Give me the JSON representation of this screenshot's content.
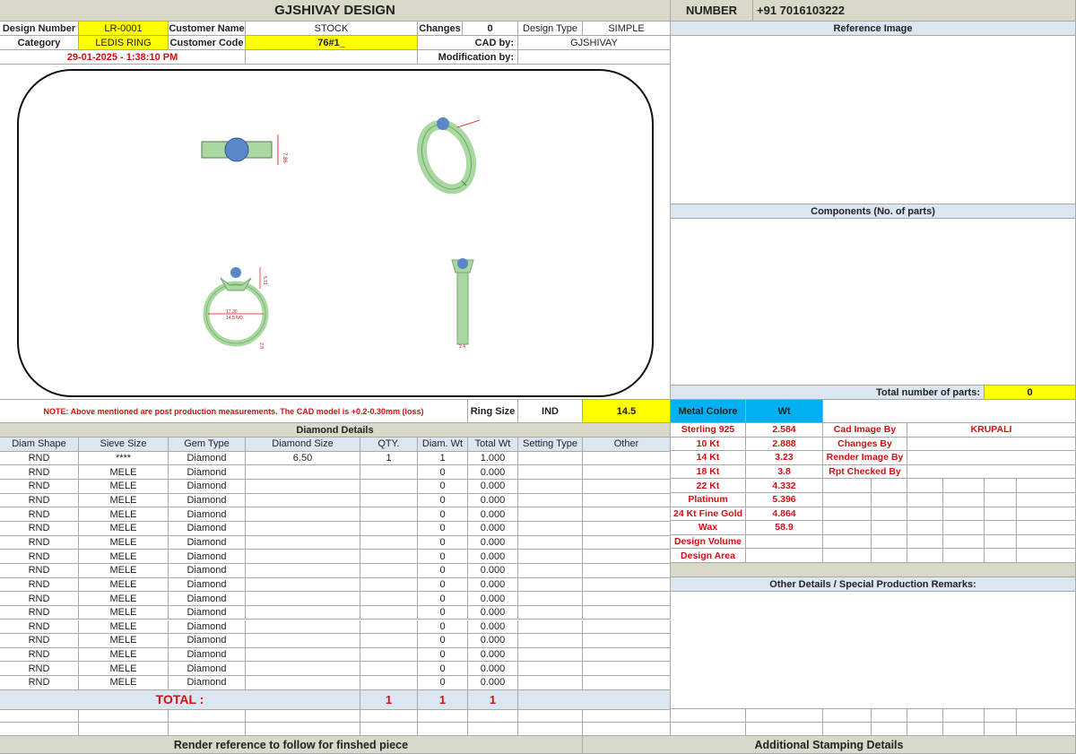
{
  "header": {
    "title": "GJSHIVAY DESIGN",
    "number_label": "NUMBER",
    "number_value": "+91 7016103222"
  },
  "info": {
    "design_number_label": "Design Number",
    "design_number": "LR-0001",
    "customer_name_label": "Customer Name",
    "customer_name": "STOCK",
    "changes_label": "Changes",
    "changes": "0",
    "design_type_label": "Design Type",
    "design_type": "SIMPLE",
    "category_label": "Category",
    "category": "LEDIS RING",
    "customer_code_label": "Customer Code",
    "customer_code": "76#1_",
    "cad_by_label": "CAD by:",
    "cad_by": "GJSHIVAY",
    "datetime": "29-01-2025 - 1:38:10 PM",
    "modification_label": "Modification by:"
  },
  "sections": {
    "reference_image": "Reference Image",
    "components": "Components (No. of parts)",
    "total_parts_label": "Total number of parts:",
    "total_parts": "0",
    "other_details": "Other Details / Special Production Remarks:",
    "render_reference": "Render reference to follow for finshed piece",
    "stamping": "Additional Stamping Details"
  },
  "drawing": {
    "dim_top": "7.86",
    "dim_inner": "17.30",
    "dim_size": "14.5 NO.",
    "dim_shank": "2.8",
    "dim_height": "5.71",
    "dim_side": "2.4"
  },
  "note": {
    "text": "NOTE: Above mentioned are post production measurements. The CAD model is +0.2-0.30mm (loss)",
    "ring_size_label": "Ring Size",
    "ring_size_std": "IND",
    "ring_size": "14.5"
  },
  "diamond": {
    "title": "Diamond Details",
    "headers": [
      "Diam Shape",
      "Sieve Size",
      "Gem Type",
      "Diamond Size",
      "QTY.",
      "Diam. Wt",
      "Total Wt",
      "Setting Type",
      "Other"
    ],
    "rows": [
      [
        "RND",
        "****",
        "Diamond",
        "6.50",
        "1",
        "1",
        "1.000",
        "",
        ""
      ],
      [
        "RND",
        "MELE",
        "Diamond",
        "",
        "",
        "0",
        "0.000",
        "",
        ""
      ],
      [
        "RND",
        "MELE",
        "Diamond",
        "",
        "",
        "0",
        "0.000",
        "",
        ""
      ],
      [
        "RND",
        "MELE",
        "Diamond",
        "",
        "",
        "0",
        "0.000",
        "",
        ""
      ],
      [
        "RND",
        "MELE",
        "Diamond",
        "",
        "",
        "0",
        "0.000",
        "",
        ""
      ],
      [
        "RND",
        "MELE",
        "Diamond",
        "",
        "",
        "0",
        "0.000",
        "",
        ""
      ],
      [
        "RND",
        "MELE",
        "Diamond",
        "",
        "",
        "0",
        "0.000",
        "",
        ""
      ],
      [
        "RND",
        "MELE",
        "Diamond",
        "",
        "",
        "0",
        "0.000",
        "",
        ""
      ],
      [
        "RND",
        "MELE",
        "Diamond",
        "",
        "",
        "0",
        "0.000",
        "",
        ""
      ],
      [
        "RND",
        "MELE",
        "Diamond",
        "",
        "",
        "0",
        "0.000",
        "",
        ""
      ],
      [
        "RND",
        "MELE",
        "Diamond",
        "",
        "",
        "0",
        "0.000",
        "",
        ""
      ],
      [
        "RND",
        "MELE",
        "Diamond",
        "",
        "",
        "0",
        "0.000",
        "",
        ""
      ],
      [
        "RND",
        "MELE",
        "Diamond",
        "",
        "",
        "0",
        "0.000",
        "",
        ""
      ],
      [
        "RND",
        "MELE",
        "Diamond",
        "",
        "",
        "0",
        "0.000",
        "",
        ""
      ],
      [
        "RND",
        "MELE",
        "Diamond",
        "",
        "",
        "0",
        "0.000",
        "",
        ""
      ],
      [
        "RND",
        "MELE",
        "Diamond",
        "",
        "",
        "0",
        "0.000",
        "",
        ""
      ],
      [
        "RND",
        "MELE",
        "Diamond",
        "",
        "",
        "0",
        "0.000",
        "",
        ""
      ]
    ],
    "total_label": "TOTAL :",
    "total_qty": "1",
    "total_diam_wt": "1",
    "total_wt": "1"
  },
  "metal": {
    "header_label": "Metal Colore",
    "header_wt": "Wt",
    "rows": [
      [
        "Sterling 925",
        "2.584"
      ],
      [
        "10 Kt",
        "2.888"
      ],
      [
        "14 Kt",
        "3.23"
      ],
      [
        "18 Kt",
        "3.8"
      ],
      [
        "22 Kt",
        "4.332"
      ],
      [
        "Platinum",
        "5.396"
      ],
      [
        "24 Kt Fine Gold",
        "4.864"
      ],
      [
        "Wax",
        "58.9"
      ],
      [
        "Design Volume",
        ""
      ],
      [
        "Design Area",
        ""
      ]
    ]
  },
  "credits": {
    "rows": [
      [
        "Cad Image By",
        "KRUPALI"
      ],
      [
        "Changes By",
        ""
      ],
      [
        "Render Image By",
        ""
      ],
      [
        "Rpt Checked By",
        ""
      ]
    ]
  },
  "colors": {
    "header_bg": "#d9d9c9",
    "highlight": "#ffff00",
    "section_blue": "#dce6f1",
    "metal_header": "#00b0f0",
    "accent_red": "#d11010",
    "ring_green": "#a9d9a0"
  }
}
